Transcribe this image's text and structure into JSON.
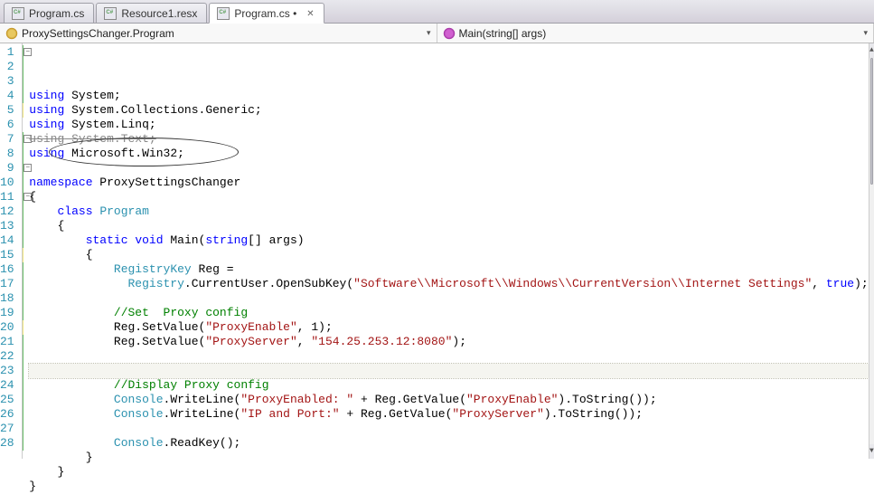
{
  "tabs": [
    {
      "label": "Program.cs",
      "active": false,
      "modified": false,
      "closeable": false
    },
    {
      "label": "Resource1.resx",
      "active": false,
      "modified": false,
      "closeable": false
    },
    {
      "label": "Program.cs",
      "active": true,
      "modified": true,
      "closeable": true
    }
  ],
  "dropdowns": {
    "class": "ProxySettingsChanger.Program",
    "method": "Main(string[] args)"
  },
  "code": {
    "lines": [
      {
        "n": 1,
        "marker": "grn",
        "outline": "minus",
        "tokens": [
          [
            "kw",
            "using"
          ],
          [
            "",
            " System;"
          ]
        ]
      },
      {
        "n": 2,
        "marker": "grn",
        "tokens": [
          [
            "kw",
            "using"
          ],
          [
            "",
            " System.Collections.Generic;"
          ]
        ]
      },
      {
        "n": 3,
        "marker": "grn",
        "tokens": [
          [
            "kw",
            "using"
          ],
          [
            "",
            " System.Linq;"
          ]
        ]
      },
      {
        "n": 4,
        "marker": "grn",
        "strike": true,
        "tokens": [
          [
            "kw",
            "using"
          ],
          [
            "",
            " System.Text;"
          ]
        ]
      },
      {
        "n": 5,
        "marker": "yel",
        "tokens": [
          [
            "kw",
            "using"
          ],
          [
            "",
            " Microsoft.Win32;"
          ]
        ]
      },
      {
        "n": 6,
        "marker": "",
        "tokens": [
          [
            "",
            ""
          ]
        ]
      },
      {
        "n": 7,
        "marker": "grn",
        "outline": "minus",
        "tokens": [
          [
            "kw",
            "namespace"
          ],
          [
            "",
            " ProxySettingsChanger"
          ]
        ]
      },
      {
        "n": 8,
        "marker": "grn",
        "tokens": [
          [
            "",
            "{"
          ]
        ]
      },
      {
        "n": 9,
        "marker": "grn",
        "outline": "minus-inner",
        "tokens": [
          [
            "",
            "    "
          ],
          [
            "kw",
            "class"
          ],
          [
            "",
            " "
          ],
          [
            "type",
            "Program"
          ]
        ]
      },
      {
        "n": 10,
        "marker": "grn",
        "tokens": [
          [
            "",
            "    {"
          ]
        ]
      },
      {
        "n": 11,
        "marker": "grn",
        "outline": "minus-inner2",
        "tokens": [
          [
            "",
            "        "
          ],
          [
            "kw",
            "static"
          ],
          [
            "",
            " "
          ],
          [
            "kw",
            "void"
          ],
          [
            "",
            " Main("
          ],
          [
            "kw",
            "string"
          ],
          [
            "",
            "[] args)"
          ]
        ]
      },
      {
        "n": 12,
        "marker": "grn",
        "tokens": [
          [
            "",
            "        {"
          ]
        ]
      },
      {
        "n": 13,
        "marker": "grn",
        "tokens": [
          [
            "",
            "            "
          ],
          [
            "type",
            "RegistryKey"
          ],
          [
            "",
            " Reg ="
          ]
        ]
      },
      {
        "n": 14,
        "marker": "grn",
        "tokens": [
          [
            "",
            "              "
          ],
          [
            "type",
            "Registry"
          ],
          [
            "",
            ".CurrentUser.OpenSubKey("
          ],
          [
            "str",
            "\"Software\\\\Microsoft\\\\Windows\\\\CurrentVersion\\\\Internet Settings\""
          ],
          [
            "",
            ", "
          ],
          [
            "kw",
            "true"
          ],
          [
            "",
            ");"
          ]
        ]
      },
      {
        "n": 15,
        "marker": "yel",
        "tokens": [
          [
            "",
            ""
          ]
        ]
      },
      {
        "n": 16,
        "marker": "grn",
        "tokens": [
          [
            "",
            "            "
          ],
          [
            "cmt",
            "//Set  Proxy config"
          ]
        ]
      },
      {
        "n": 17,
        "marker": "grn",
        "tokens": [
          [
            "",
            "            Reg.SetValue("
          ],
          [
            "str",
            "\"ProxyEnable\""
          ],
          [
            "",
            ", 1);"
          ]
        ]
      },
      {
        "n": 18,
        "marker": "grn",
        "tokens": [
          [
            "",
            "            Reg.SetValue("
          ],
          [
            "str",
            "\"ProxyServer\""
          ],
          [
            "",
            ", "
          ],
          [
            "str",
            "\"154.25.253.12:8080\""
          ],
          [
            "",
            ");"
          ]
        ]
      },
      {
        "n": 19,
        "marker": "grn",
        "tokens": [
          [
            "",
            ""
          ]
        ]
      },
      {
        "n": 20,
        "marker": "yel",
        "current": true,
        "tokens": [
          [
            "",
            ""
          ]
        ]
      },
      {
        "n": 21,
        "marker": "grn",
        "tokens": [
          [
            "",
            "            "
          ],
          [
            "cmt",
            "//Display Proxy config"
          ]
        ]
      },
      {
        "n": 22,
        "marker": "grn",
        "tokens": [
          [
            "",
            "            "
          ],
          [
            "type",
            "Console"
          ],
          [
            "",
            ".WriteLine("
          ],
          [
            "str",
            "\"ProxyEnabled: \""
          ],
          [
            "",
            " + Reg.GetValue("
          ],
          [
            "str",
            "\"ProxyEnable\""
          ],
          [
            "",
            ").ToString());"
          ]
        ]
      },
      {
        "n": 23,
        "marker": "grn",
        "tokens": [
          [
            "",
            "            "
          ],
          [
            "type",
            "Console"
          ],
          [
            "",
            ".WriteLine("
          ],
          [
            "str",
            "\"IP and Port:\""
          ],
          [
            "",
            " + Reg.GetValue("
          ],
          [
            "str",
            "\"ProxyServer\""
          ],
          [
            "",
            ").ToString());"
          ]
        ]
      },
      {
        "n": 24,
        "marker": "grn",
        "tokens": [
          [
            "",
            ""
          ]
        ]
      },
      {
        "n": 25,
        "marker": "grn",
        "tokens": [
          [
            "",
            "            "
          ],
          [
            "type",
            "Console"
          ],
          [
            "",
            ".ReadKey();"
          ]
        ]
      },
      {
        "n": 26,
        "marker": "grn",
        "tokens": [
          [
            "",
            "        }"
          ]
        ]
      },
      {
        "n": 27,
        "marker": "grn",
        "tokens": [
          [
            "",
            "    }"
          ]
        ]
      },
      {
        "n": 28,
        "marker": "grn",
        "tokens": [
          [
            "",
            "}"
          ]
        ]
      }
    ]
  }
}
